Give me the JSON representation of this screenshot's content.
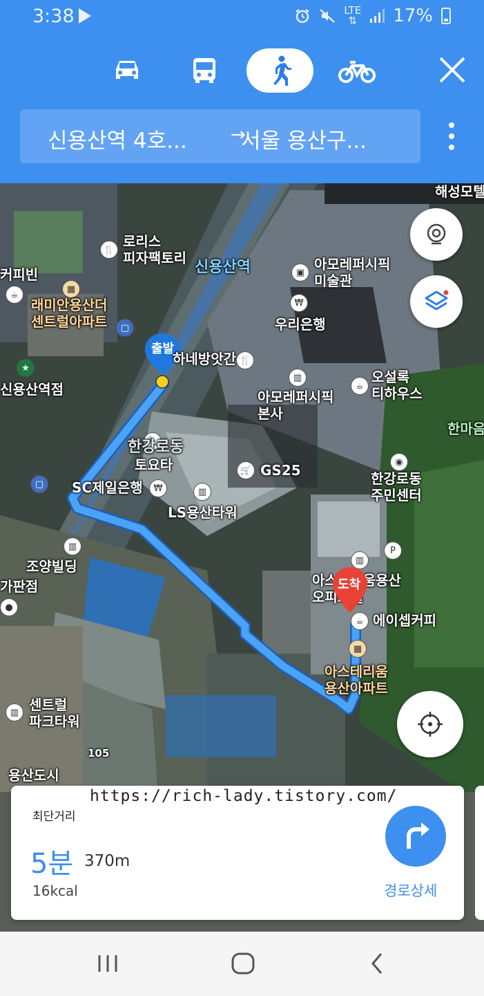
{
  "status": {
    "time": "3:38",
    "battery": "17%",
    "network": "LTE"
  },
  "modes": [
    {
      "name": "car-icon",
      "selected": false
    },
    {
      "name": "bus-icon",
      "selected": false
    },
    {
      "name": "walk-icon",
      "selected": true
    },
    {
      "name": "bike-icon",
      "selected": false
    }
  ],
  "route": {
    "from": "신용산역 4호...",
    "arrow": "→",
    "to": "서울 용산구..."
  },
  "map": {
    "labels": {
      "haeseong": "해성모텔",
      "lorris": "로리스\n피자팩토리",
      "sinyongsan_station": "신용산역",
      "amore_museum": "아모레퍼시픽\n미술관",
      "coffeebean": "커피빈",
      "raemian": "래미안용산더\n센트럴아파트",
      "woori": "우리은행",
      "start": "출발",
      "hanebang": "하네방앗간",
      "sinyongsan_entrance": "신용산역점",
      "amore_hq": "아모레퍼시픽\n본사",
      "osulloc": "오설록\n티하우스",
      "hanmaeum": "한마음",
      "toyota": "토요타",
      "hangangrodong": "한강로동",
      "gs25": "GS25",
      "sc_bank": "SC제일은행",
      "ls_tower": "LS용산타워",
      "community_center": "한강로동\n주민센터",
      "joyang": "조양빌딩",
      "gapanjeom": "가판점",
      "astelle": "아스테리움용산\n오피스텔",
      "arrive": "도착",
      "ace_coffee": "에이셉커피",
      "astelle_apt": "아스테리움\n용산아파트",
      "central_park": "센트럴\n파크타워",
      "yongsan_dosi": "용산도시",
      "road_105": "105"
    }
  },
  "card": {
    "label": "최단거리",
    "time": "5분",
    "distance": "370m",
    "kcal": "16kcal",
    "details": "경로상세"
  },
  "watermark": "https://rich-lady.tistory.com/"
}
